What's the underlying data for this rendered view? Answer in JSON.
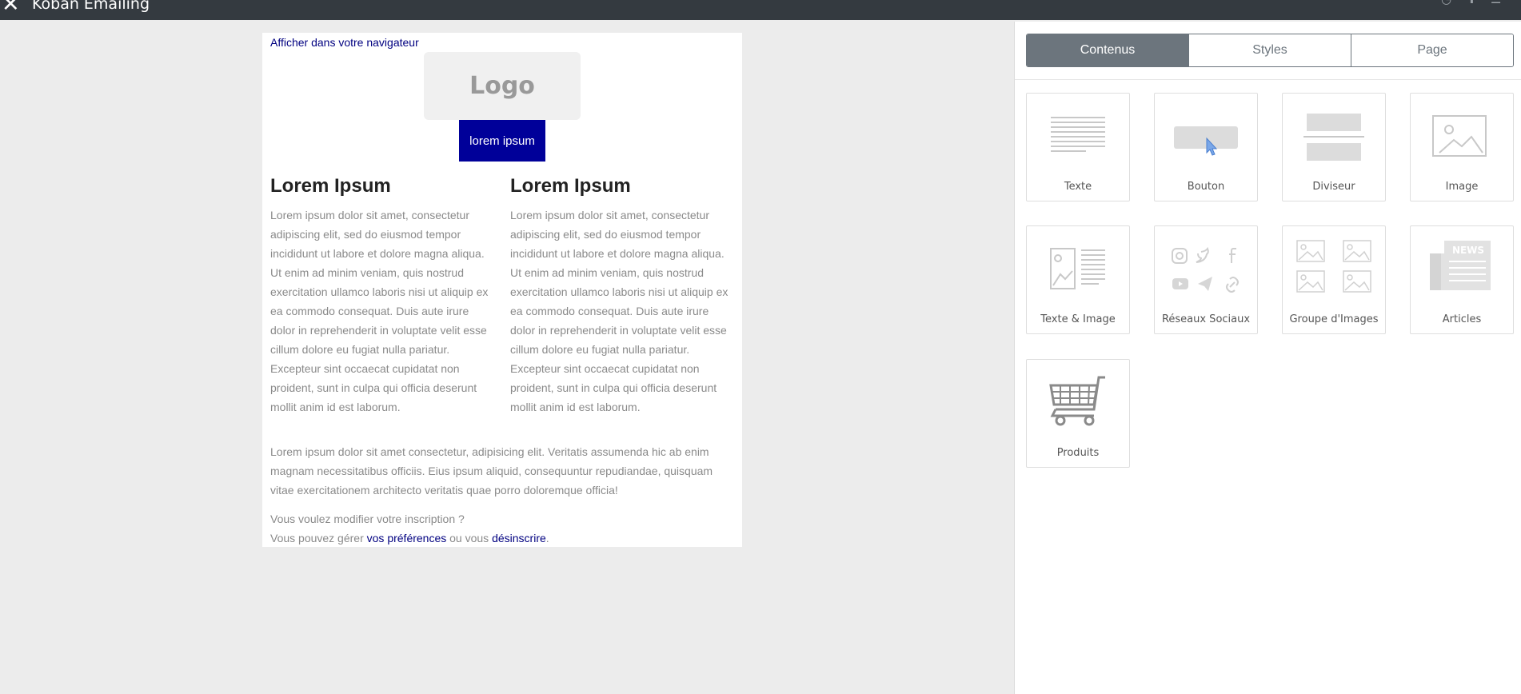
{
  "app": {
    "title": "Koban Emailing"
  },
  "email": {
    "browser_link": "Afficher dans votre navigateur",
    "logo_text": "Logo",
    "cta_button": "lorem ipsum",
    "columns": [
      {
        "heading": "Lorem Ipsum",
        "body": "Lorem ipsum dolor sit amet, consectetur adipiscing elit, sed do eiusmod tempor incididunt ut labore et dolore magna aliqua. Ut enim ad minim veniam, quis nostrud exercitation ullamco laboris nisi ut aliquip ex ea commodo consequat. Duis aute irure dolor in reprehenderit in voluptate velit esse cillum dolore eu fugiat nulla pariatur. Excepteur sint occaecat cupidatat non proident, sunt in culpa qui officia deserunt mollit anim id est laborum."
      },
      {
        "heading": "Lorem Ipsum",
        "body": "Lorem ipsum dolor sit amet, consectetur adipiscing elit, sed do eiusmod tempor incididunt ut labore et dolore magna aliqua. Ut enim ad minim veniam, quis nostrud exercitation ullamco laboris nisi ut aliquip ex ea commodo consequat. Duis aute irure dolor in reprehenderit in voluptate velit esse cillum dolore eu fugiat nulla pariatur. Excepteur sint occaecat cupidatat non proident, sunt in culpa qui officia deserunt mollit anim id est laborum."
      }
    ],
    "full_paragraph": "Lorem ipsum dolor sit amet consectetur, adipisicing elit. Veritatis assumenda hic ab enim magnam necessitatibus officiis. Eius ipsum aliquid, consequuntur repudiandae, quisquam vitae exercitationem architecto veritatis quae porro doloremque officia!",
    "footer": {
      "question": "Vous voulez modifier votre inscription ?",
      "manage_prefix": "Vous pouvez gérer ",
      "preferences_link": "vos préférences",
      "middle": " ou vous ",
      "unsubscribe_link": "désinscrire",
      "suffix": "."
    }
  },
  "panel": {
    "tabs": [
      {
        "label": "Contenus",
        "active": true
      },
      {
        "label": "Styles",
        "active": false
      },
      {
        "label": "Page",
        "active": false
      }
    ],
    "blocks": [
      {
        "label": "Texte",
        "icon": "text-block-icon"
      },
      {
        "label": "Bouton",
        "icon": "button-block-icon"
      },
      {
        "label": "Diviseur",
        "icon": "divider-block-icon"
      },
      {
        "label": "Image",
        "icon": "image-block-icon"
      },
      {
        "label": "Texte & Image",
        "icon": "text-image-block-icon"
      },
      {
        "label": "Réseaux Sociaux",
        "icon": "social-block-icon"
      },
      {
        "label": "Groupe d'Images",
        "icon": "image-group-block-icon"
      },
      {
        "label": "Articles",
        "icon": "news-block-icon"
      },
      {
        "label": "Produits",
        "icon": "cart-block-icon"
      }
    ],
    "news_icon_text": "NEWS"
  },
  "colors": {
    "topbar": "#343a40",
    "link": "#000080",
    "cta": "#000099",
    "tab_active": "#6c757d"
  }
}
